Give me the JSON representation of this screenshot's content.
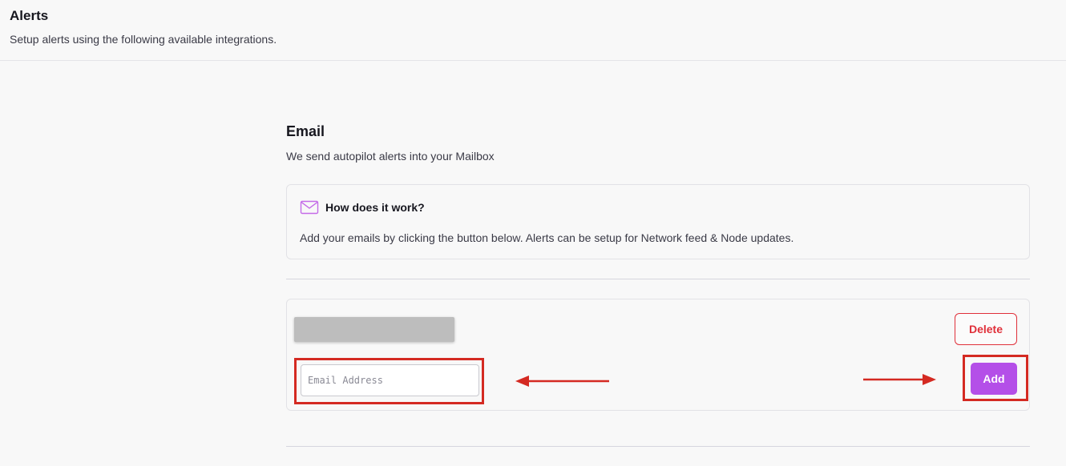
{
  "header": {
    "title": "Alerts",
    "subtitle": "Setup alerts using the following available integrations."
  },
  "email_section": {
    "title": "Email",
    "subtitle": "We send autopilot alerts into your Mailbox",
    "info": {
      "icon": "mail-icon",
      "title": "How does it work?",
      "text": "Add your emails by clicking the button below. Alerts can be setup for Network feed & Node updates."
    },
    "entry": {
      "delete_label": "Delete",
      "email_placeholder": "Email Address",
      "add_label": "Add"
    }
  },
  "colors": {
    "accent_purple": "#b44fe8",
    "danger_red": "#e0303a",
    "annotation_red": "#d42a22"
  }
}
